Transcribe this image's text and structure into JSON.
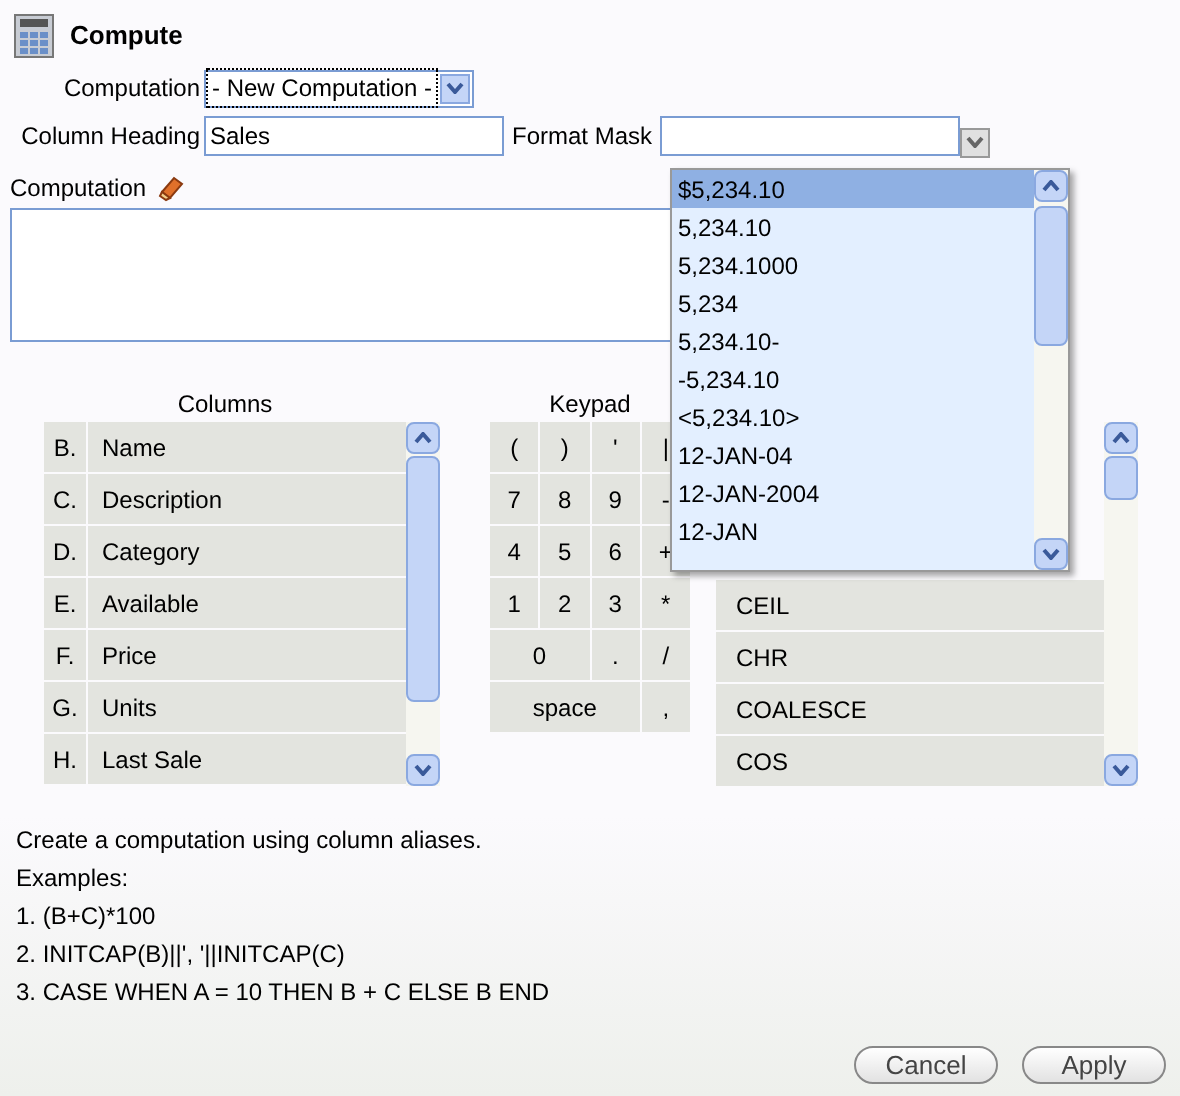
{
  "title": "Compute",
  "computation_select": {
    "label": "Computation",
    "value": "- New Computation -"
  },
  "column_heading": {
    "label": "Column Heading",
    "value": "Sales"
  },
  "format_mask": {
    "label": "Format Mask",
    "expanded": true,
    "options": [
      {
        "label": "$5,234.10",
        "selected": true
      },
      {
        "label": "5,234.10",
        "selected": false
      },
      {
        "label": "5,234.1000",
        "selected": false
      },
      {
        "label": "5,234",
        "selected": false
      },
      {
        "label": "5,234.10-",
        "selected": false
      },
      {
        "label": "-5,234.10",
        "selected": false
      },
      {
        "label": "<5,234.10>",
        "selected": false
      },
      {
        "label": "12-JAN-04",
        "selected": false
      },
      {
        "label": "12-JAN-2004",
        "selected": false
      },
      {
        "label": "12-JAN",
        "selected": false
      }
    ]
  },
  "computation_label": "Computation",
  "columns": {
    "title": "Columns",
    "items": [
      {
        "alias": "B.",
        "name": "Name"
      },
      {
        "alias": "C.",
        "name": "Description"
      },
      {
        "alias": "D.",
        "name": "Category"
      },
      {
        "alias": "E.",
        "name": "Available"
      },
      {
        "alias": "F.",
        "name": "Price"
      },
      {
        "alias": "G.",
        "name": "Units"
      },
      {
        "alias": "H.",
        "name": "Last Sale"
      }
    ]
  },
  "keypad": {
    "title": "Keypad",
    "rows": [
      [
        "(",
        ")",
        "'",
        "|"
      ],
      [
        "7",
        "8",
        "9",
        "-"
      ],
      [
        "4",
        "5",
        "6",
        "+"
      ],
      [
        "1",
        "2",
        "3",
        "*"
      ],
      [
        "0",
        "",
        ".",
        "/"
      ],
      [
        "space",
        "",
        "",
        ","
      ]
    ]
  },
  "functions": {
    "items": [
      "CEIL",
      "CHR",
      "COALESCE",
      "COS"
    ]
  },
  "help": {
    "intro": "Create a computation using column aliases.",
    "examples_label": "Examples:",
    "examples": [
      "1. (B+C)*100",
      "2. INITCAP(B)||', '||INITCAP(C)",
      "3. CASE WHEN A = 10 THEN B + C ELSE B END"
    ]
  },
  "buttons": [
    "Cancel",
    "Apply"
  ]
}
